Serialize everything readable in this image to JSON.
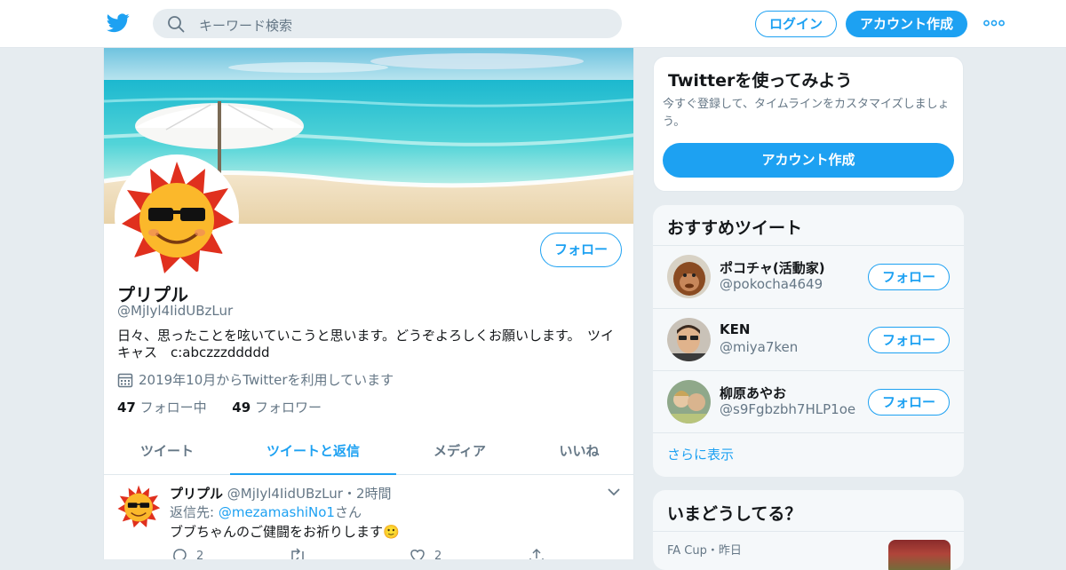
{
  "header": {
    "search_placeholder": "キーワード検索",
    "login_label": "ログイン",
    "signup_label": "アカウント作成"
  },
  "profile": {
    "follow_label": "フォロー",
    "name": "プリプル",
    "handle": "@MjIyl4IidUBzLur",
    "bio": "日々、思ったことを呟いていこうと思います。どうぞよろしくお願いします。　ツイキャス　c:abczzzddddd",
    "joined": "2019年10月からTwitterを利用しています",
    "following_count": "47",
    "following_label": "フォロー中",
    "followers_count": "49",
    "followers_label": "フォロワー"
  },
  "tabs": [
    {
      "label": "ツイート",
      "active": false
    },
    {
      "label": "ツイートと返信",
      "active": true
    },
    {
      "label": "メディア",
      "active": false
    },
    {
      "label": "いいね",
      "active": false
    }
  ],
  "tweet": {
    "author": "プリプル",
    "handle": "@MjIyl4IidUBzLur",
    "sep": "・",
    "time": "2時間",
    "reply_prefix": "返信先: ",
    "reply_to": "@mezamashiNo1",
    "reply_suffix": "さん",
    "text": "ブブちゃんのご健闘をお祈りします🙂",
    "reply_count": "2",
    "like_count": "2"
  },
  "signup_card": {
    "title": "Twitterを使ってみよう",
    "description": "今すぐ登録して、タイムラインをカスタマイズしましょう。",
    "cta_label": "アカウント作成"
  },
  "suggestions": {
    "title": "おすすめツイート",
    "follow_label": "フォロー",
    "items": [
      {
        "name": "ポコチャ(活動家)",
        "handle": "@pokocha4649"
      },
      {
        "name": "KEN",
        "handle": "@miya7ken"
      },
      {
        "name": "柳原あやお",
        "handle": "@s9Fgbzbh7HLP1oe"
      }
    ],
    "more_label": "さらに表示"
  },
  "trends": {
    "title": "いまどうしてる？",
    "meta": "FA Cup・昨日"
  },
  "colors": {
    "accent": "#1da1f2",
    "background": "#e6ecf0",
    "secondary_text": "#657786"
  }
}
